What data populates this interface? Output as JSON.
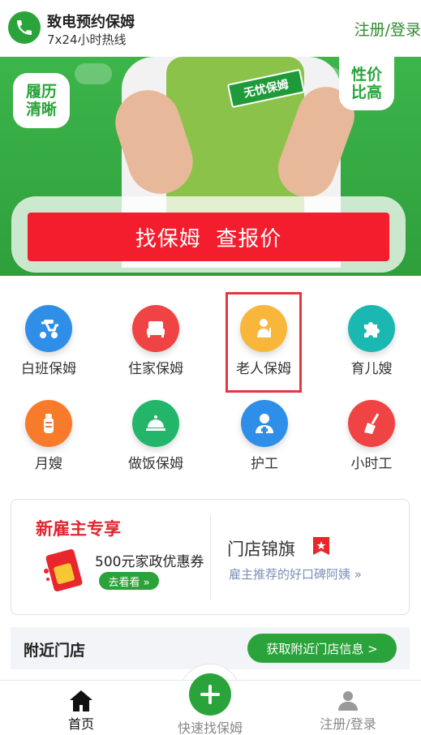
{
  "header": {
    "brand": "致电预约保姆",
    "hotline": "7x24小时热线",
    "login": "注册/登录"
  },
  "banner": {
    "left_bubble": "履历\n清晰",
    "right_bubble": "性价\n比高",
    "tag": "无忧保姆",
    "cta": "找保姆  查报价"
  },
  "services": [
    {
      "label": "白班保姆",
      "icon": "scooter-icon",
      "color": "#2f8fe8"
    },
    {
      "label": "住家保姆",
      "icon": "bed-icon",
      "color": "#f04444"
    },
    {
      "label": "老人保姆",
      "icon": "elderly-icon",
      "color": "#f8b73a",
      "selected": true
    },
    {
      "label": "育儿嫂",
      "icon": "puzzle-icon",
      "color": "#1bb8b2"
    },
    {
      "label": "月嫂",
      "icon": "baby-bottle-icon",
      "color": "#f77b2a"
    },
    {
      "label": "做饭保姆",
      "icon": "cloche-icon",
      "color": "#23b56a"
    },
    {
      "label": "护工",
      "icon": "nurse-icon",
      "color": "#2f8fe8"
    },
    {
      "label": "小时工",
      "icon": "broom-icon",
      "color": "#f04444"
    }
  ],
  "promo": {
    "title": "新雇主专享",
    "coupon": "500元家政优惠券",
    "coupon_btn": "去看看 »",
    "store_title": "门店锦旗",
    "store_sub": "雇主推荐的好口碑阿姨 »"
  },
  "nearby": {
    "title": "附近门店",
    "button": "获取附近门店信息 >"
  },
  "tabbar": {
    "home": "首页",
    "quick": "快速找保姆",
    "account": "注册/登录"
  },
  "colors": {
    "brand_green": "#2aa43a",
    "cta_red": "#f31d2e",
    "highlight_red": "#e0393e"
  }
}
